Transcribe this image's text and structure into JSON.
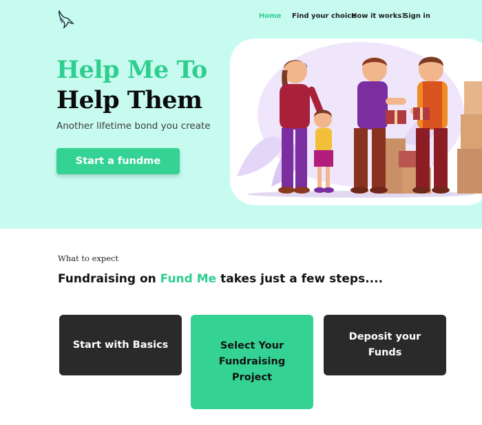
{
  "nav": {
    "home": "Home",
    "find_choice": "Find your choice",
    "how_it_works": "How it works?",
    "sign_in": "Sign in"
  },
  "hero": {
    "title_line1": "Help Me To",
    "title_line2": "Help Them",
    "subtitle": "Another lifetime bond you create",
    "cta_label": "Start a fundme"
  },
  "icons": {
    "logo": "bird-logo-icon",
    "illustration": "family-giving-boxes-illustration"
  },
  "colors": {
    "accent": "#2fce8f",
    "hero_bg": "#c8fbf0",
    "dark_card": "#2a2a2a"
  },
  "section": {
    "label": "What to expect",
    "heading_prefix": "Fundraising on ",
    "heading_brand": "Fund Me",
    "heading_suffix": " takes just a few steps...."
  },
  "steps": [
    {
      "label": "Start with Basics"
    },
    {
      "label": "Select Your Fundraising Project"
    },
    {
      "label": "Deposit your Funds"
    }
  ]
}
